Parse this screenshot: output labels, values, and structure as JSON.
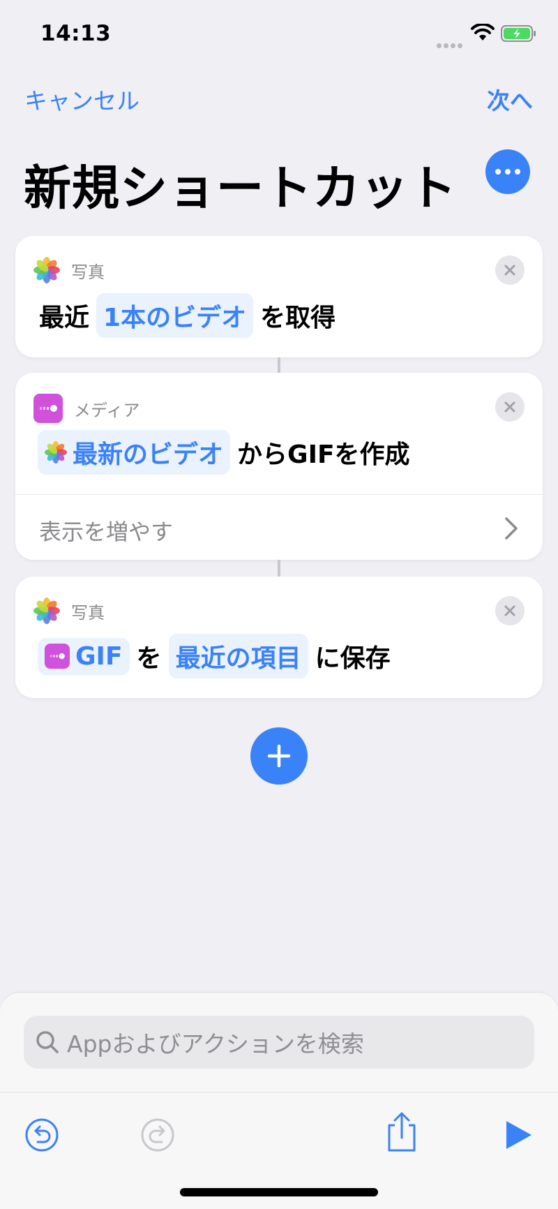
{
  "status_bar": {
    "time": "14:13"
  },
  "nav": {
    "cancel_label": "キャンセル",
    "next_label": "次へ"
  },
  "page": {
    "title": "新規ショートカット"
  },
  "actions": [
    {
      "app_label": "写真",
      "icon": "photos-icon",
      "parts": {
        "prefix": "最近",
        "token": "1本のビデオ",
        "suffix": "を取得"
      }
    },
    {
      "app_label": "メディア",
      "icon": "media-icon",
      "parts": {
        "token": "最新のビデオ",
        "suffix": "からGIFを作成"
      },
      "more_label": "表示を増やす"
    },
    {
      "app_label": "写真",
      "icon": "photos-icon",
      "parts": {
        "token1": "GIF",
        "mid": "を",
        "token2": "最近の項目",
        "suffix": "に保存"
      }
    }
  ],
  "search": {
    "placeholder": "Appおよびアクションを検索"
  },
  "colors": {
    "accent": "#3a82f7",
    "media": "#d051db",
    "background": "#efeff4"
  }
}
